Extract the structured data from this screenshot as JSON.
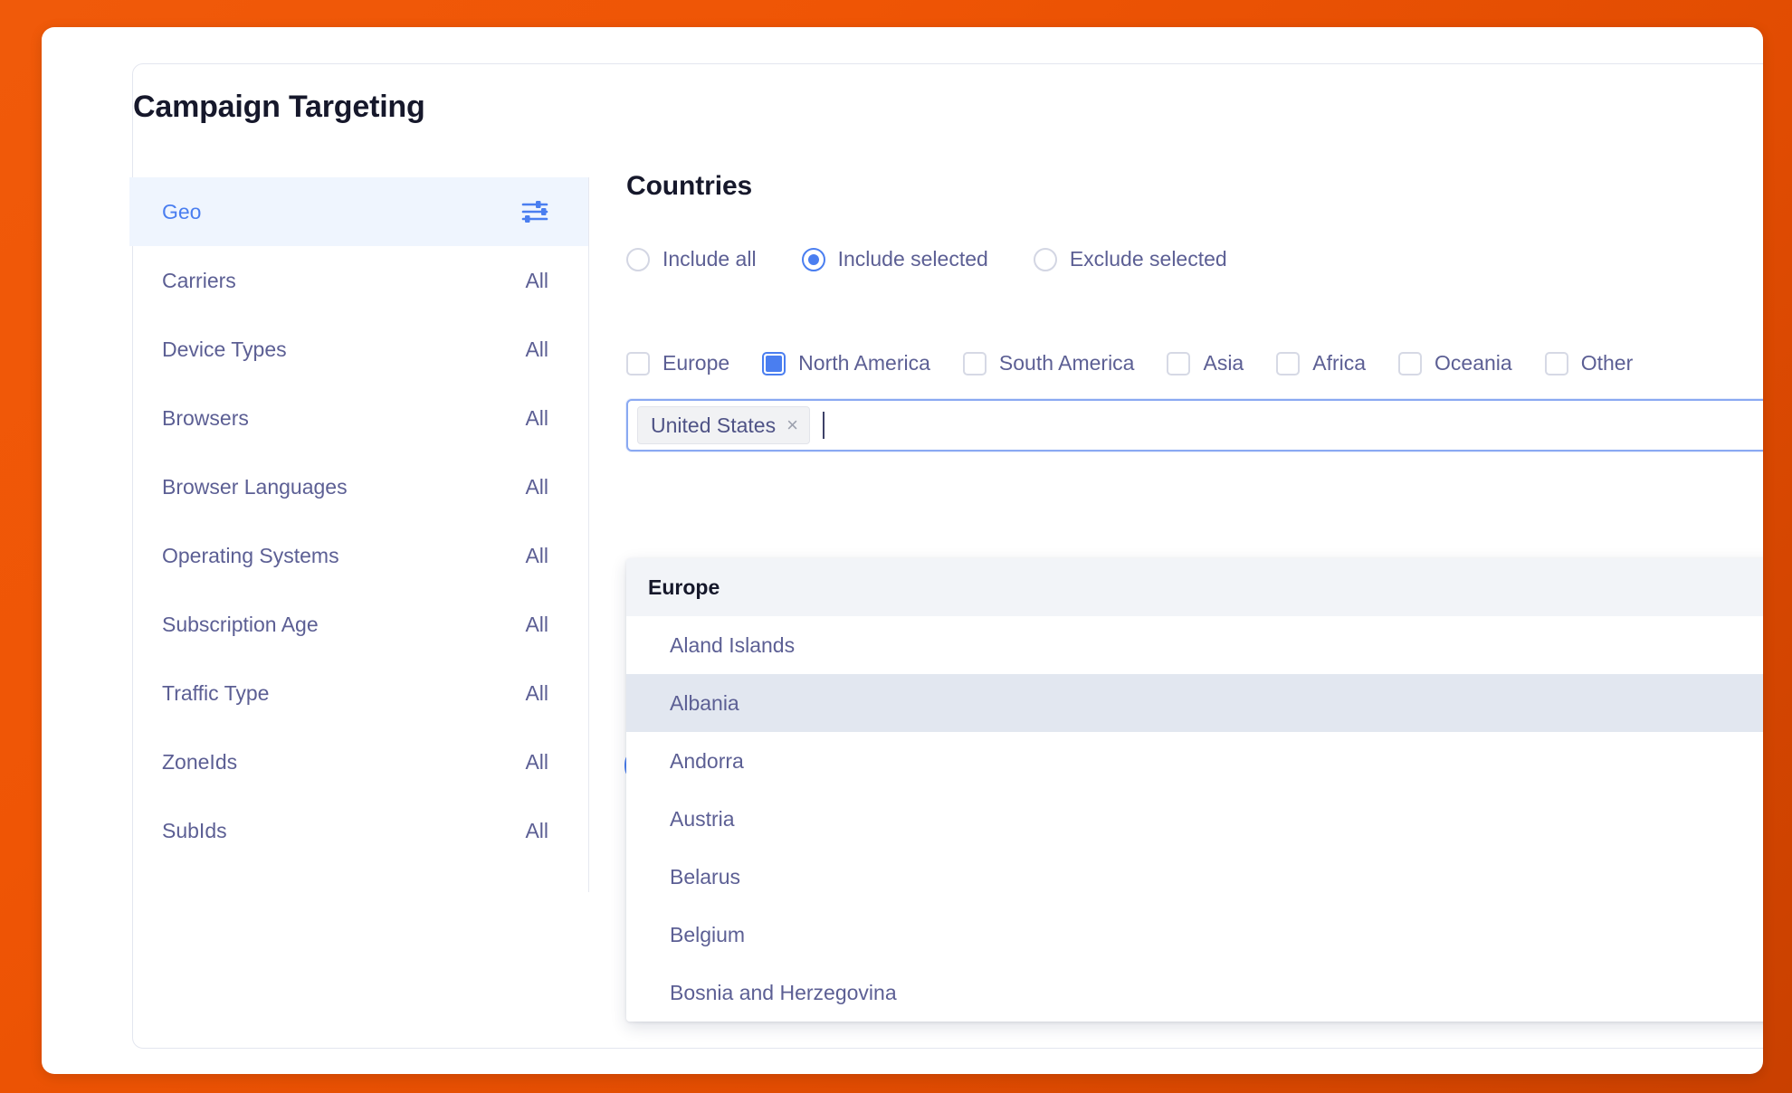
{
  "page": {
    "title": "Campaign Targeting"
  },
  "sidebar": {
    "items": [
      {
        "label": "Geo",
        "value": "",
        "icon": "sliders-icon",
        "active": true
      },
      {
        "label": "Carriers",
        "value": "All",
        "icon": "",
        "active": false
      },
      {
        "label": "Device Types",
        "value": "All",
        "icon": "",
        "active": false
      },
      {
        "label": "Browsers",
        "value": "All",
        "icon": "",
        "active": false
      },
      {
        "label": "Browser Languages",
        "value": "All",
        "icon": "",
        "active": false
      },
      {
        "label": "Operating Systems",
        "value": "All",
        "icon": "",
        "active": false
      },
      {
        "label": "Subscription Age",
        "value": "All",
        "icon": "",
        "active": false
      },
      {
        "label": "Traffic Type",
        "value": "All",
        "icon": "",
        "active": false
      },
      {
        "label": "ZoneIds",
        "value": "All",
        "icon": "",
        "active": false
      },
      {
        "label": "SubIds",
        "value": "All",
        "icon": "",
        "active": false
      }
    ]
  },
  "main": {
    "section_title": "Countries",
    "mode_options": [
      {
        "label": "Include all",
        "checked": false
      },
      {
        "label": "Include selected",
        "checked": true
      },
      {
        "label": "Exclude selected",
        "checked": false
      }
    ],
    "regions": [
      {
        "label": "Europe",
        "state": "unchecked"
      },
      {
        "label": "North America",
        "state": "partial"
      },
      {
        "label": "South America",
        "state": "unchecked"
      },
      {
        "label": "Asia",
        "state": "unchecked"
      },
      {
        "label": "Africa",
        "state": "unchecked"
      },
      {
        "label": "Oceania",
        "state": "unchecked"
      },
      {
        "label": "Other",
        "state": "unchecked"
      }
    ],
    "country_input": {
      "tags": [
        {
          "label": "United States",
          "remove_icon": "close-icon"
        }
      ],
      "placeholder": "",
      "value": ""
    },
    "dropdown": {
      "group_label": "Europe",
      "items": [
        {
          "label": "Aland Islands",
          "hovered": false
        },
        {
          "label": "Albania",
          "hovered": true
        },
        {
          "label": "Andorra",
          "hovered": false
        },
        {
          "label": "Austria",
          "hovered": false
        },
        {
          "label": "Belarus",
          "hovered": false
        },
        {
          "label": "Belgium",
          "hovered": false
        },
        {
          "label": "Bosnia and Herzegovina",
          "hovered": false
        }
      ]
    }
  },
  "colors": {
    "background_orange": "#ef5505",
    "accent_blue": "#4a7ef0",
    "text_slate": "#5c5f94",
    "heading_dark": "#16182b",
    "active_row_bg": "#eff5fe",
    "hover_row_bg": "#e2e7f0",
    "group_header_bg": "#f2f4f8"
  }
}
